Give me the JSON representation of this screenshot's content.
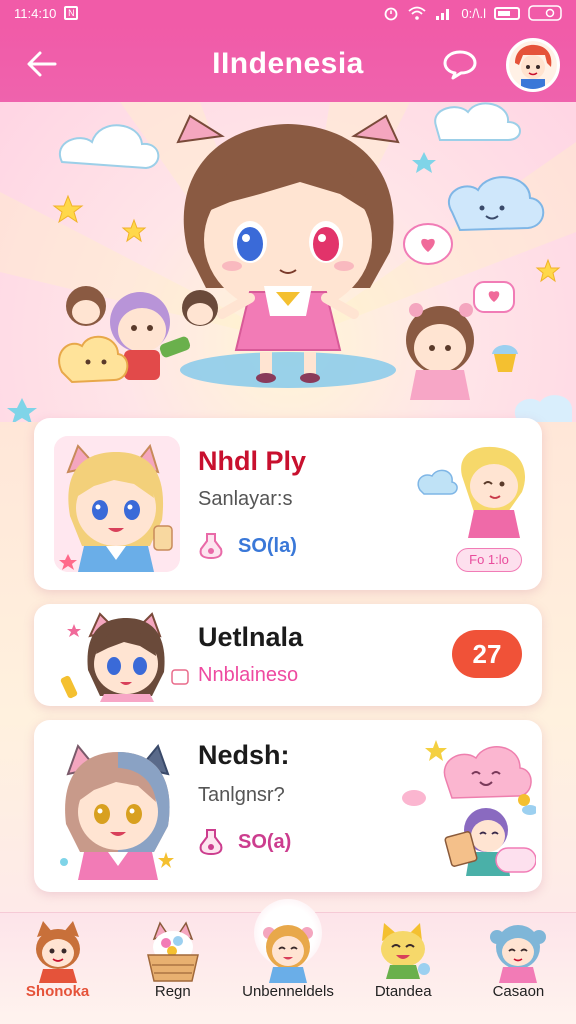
{
  "status_bar": {
    "time": "11:4:10",
    "badge": "N",
    "net_label": "0:/\\.l",
    "battery_label": ""
  },
  "app_bar": {
    "title": "IIndenesia"
  },
  "cards": [
    {
      "title": "Nhdl Ply",
      "subtitle": "Sanlayar:s",
      "price": "SO(la)",
      "chip": "Fo 1:lo"
    },
    {
      "title": "Uetlnala",
      "subtitle": "Nnblaineso",
      "badge": "27"
    },
    {
      "title": "Nedsh:",
      "subtitle": "Tanlgnsr?",
      "price": "SO(a)"
    }
  ],
  "bottom_nav": {
    "items": [
      {
        "label": "Shonoka",
        "active": true
      },
      {
        "label": "Regn"
      },
      {
        "label": "Unbenneldels"
      },
      {
        "label": "Dtandea"
      },
      {
        "label": "Casaon"
      }
    ]
  },
  "colors": {
    "accent_pink": "#f15ba8",
    "title_red": "#c8102e",
    "badge_orange": "#f05238",
    "price_blue": "#3a78d8"
  },
  "icons": {
    "back": "arrow-left-icon",
    "chat": "chat-bubble-icon",
    "price": "potion-bottle-icon"
  }
}
